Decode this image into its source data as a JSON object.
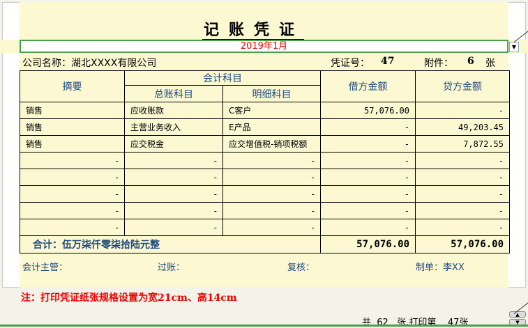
{
  "title": "记账凭证",
  "period": "2019年1月",
  "company_label": "公司名称：湖北XXXX有限公司",
  "voucher_no_label": "凭证号：",
  "voucher_no": "47",
  "attachments_label": "附件：",
  "attachments": "6",
  "attachments_unit": "张",
  "headers": {
    "summary": "摘要",
    "account": "会计科目",
    "general": "总账科目",
    "detail": "明细科目",
    "debit": "借方金额",
    "credit": "贷方金额"
  },
  "rows": [
    {
      "summary": "销售",
      "general": "应收账款",
      "detail": "C客户",
      "debit": "57,076.00",
      "credit": "-"
    },
    {
      "summary": "销售",
      "general": "主营业务收入",
      "detail": "E产品",
      "debit": "-",
      "credit": "49,203.45"
    },
    {
      "summary": "销售",
      "general": "应交税金",
      "detail": "应交增值税-销项税额",
      "debit": "-",
      "credit": "7,872.55"
    },
    {
      "summary": "-",
      "general": "-",
      "detail": "-",
      "debit": "-",
      "credit": "-"
    },
    {
      "summary": "-",
      "general": "-",
      "detail": "-",
      "debit": "-",
      "credit": "-"
    },
    {
      "summary": "-",
      "general": "-",
      "detail": "-",
      "debit": "-",
      "credit": "-"
    },
    {
      "summary": "-",
      "general": "-",
      "detail": "-",
      "debit": "-",
      "credit": "-"
    },
    {
      "summary": "-",
      "general": "-",
      "detail": "-",
      "debit": "-",
      "credit": "-"
    }
  ],
  "total": {
    "label": "合计：伍万柒仟零柒拾陆元整",
    "debit": "57,076.00",
    "credit": "57,076.00"
  },
  "signatures": {
    "supervisor": "会计主管：",
    "posting": "过账：",
    "review": "复核：",
    "maker": "制单：李XX"
  },
  "note": "注：打印凭证纸张规格设置为宽21cm、高14cm",
  "pager": {
    "prefix": "共",
    "total": "62",
    "middle": "张,打印第",
    "current": "47张"
  }
}
